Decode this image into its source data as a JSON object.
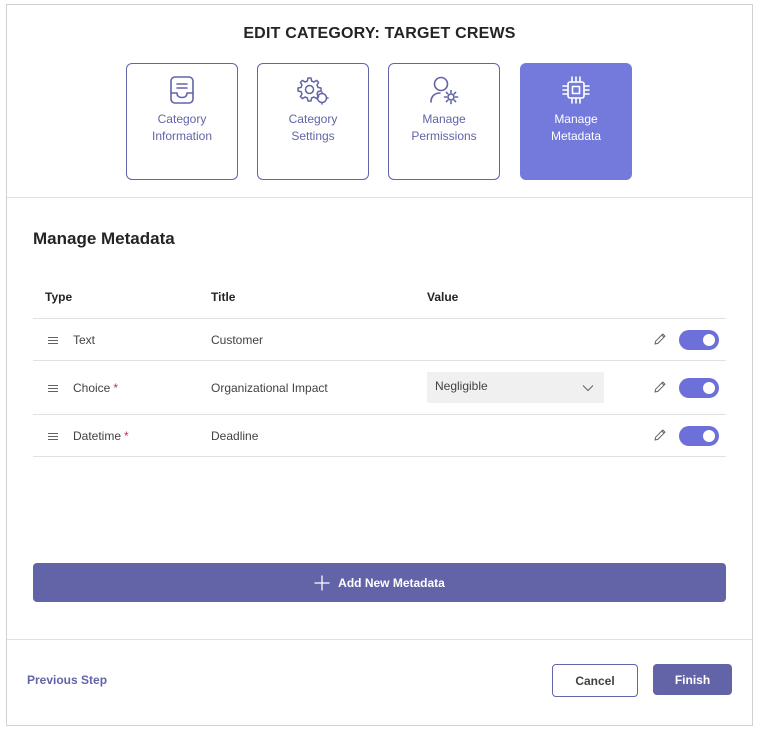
{
  "dialog": {
    "title": "EDIT CATEGORY: TARGET CREWS"
  },
  "steps": [
    {
      "label": "Category\nInformation",
      "icon": "inbox-document-icon",
      "active": false
    },
    {
      "label": "Category\nSettings",
      "icon": "gears-icon",
      "active": false
    },
    {
      "label": "Manage\nPermissions",
      "icon": "person-settings-icon",
      "active": false
    },
    {
      "label": "Manage\nMetadata",
      "icon": "chip-icon",
      "active": true
    }
  ],
  "section": {
    "title": "Manage Metadata"
  },
  "table": {
    "headers": {
      "type": "Type",
      "title": "Title",
      "value": "Value"
    },
    "rows": [
      {
        "type": "Text",
        "required": false,
        "title": "Customer",
        "value": "",
        "enabled": true
      },
      {
        "type": "Choice",
        "required": true,
        "title": "Organizational Impact",
        "value": "Negligible",
        "enabled": true
      },
      {
        "type": "Datetime",
        "required": true,
        "title": "Deadline",
        "value": "",
        "enabled": true
      }
    ],
    "required_marker": "*"
  },
  "actions": {
    "add_label": "Add New Metadata",
    "previous_label": "Previous Step",
    "cancel_label": "Cancel",
    "finish_label": "Finish"
  },
  "colors": {
    "accent": "#6264a7",
    "active_step": "#7479dc",
    "required": "#c4314b"
  }
}
